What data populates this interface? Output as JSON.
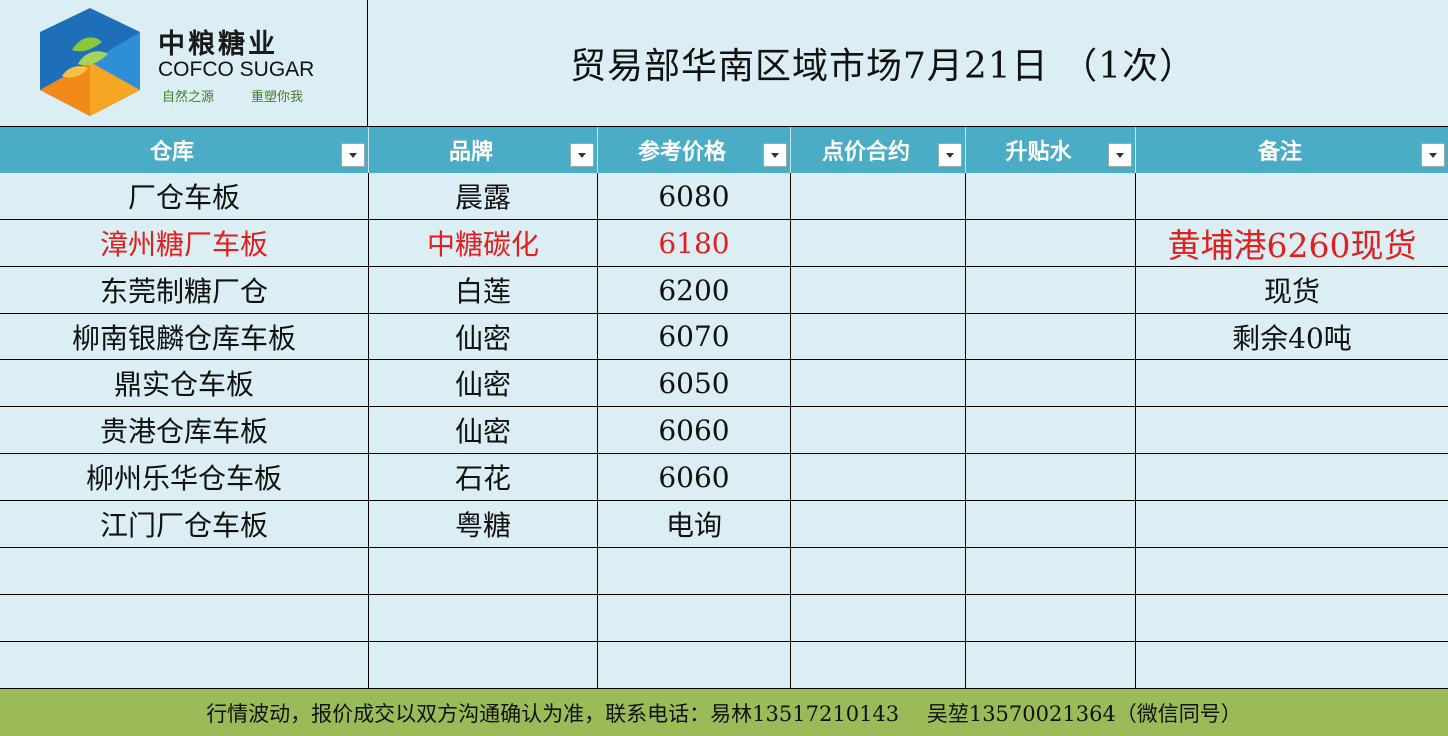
{
  "logo": {
    "name_cn": "中粮糖业",
    "name_en": "COFCO SUGAR",
    "tagline_left": "自然之源",
    "tagline_right": "重塑你我"
  },
  "title": "贸易部华南区域市场7月21日 （1次）",
  "columns": [
    "仓库",
    "品牌",
    "参考价格",
    "点价合约",
    "升贴水",
    "备注"
  ],
  "rows": [
    {
      "warehouse": "厂仓车板",
      "brand": "晨露",
      "price": "6080",
      "contract": "",
      "premium": "",
      "note": "",
      "highlight": false
    },
    {
      "warehouse": "漳州糖厂车板",
      "brand": "中糖碳化",
      "price": "6180",
      "contract": "",
      "premium": "",
      "note": "黄埔港6260现货",
      "highlight": true
    },
    {
      "warehouse": "东莞制糖厂仓",
      "brand": "白莲",
      "price": "6200",
      "contract": "",
      "premium": "",
      "note": "现货",
      "highlight": false
    },
    {
      "warehouse": "柳南银麟仓库车板",
      "brand": "仙密",
      "price": "6070",
      "contract": "",
      "premium": "",
      "note": "剩余40吨",
      "highlight": false
    },
    {
      "warehouse": "鼎实仓车板",
      "brand": "仙密",
      "price": "6050",
      "contract": "",
      "premium": "",
      "note": "",
      "highlight": false
    },
    {
      "warehouse": "贵港仓库车板",
      "brand": "仙密",
      "price": "6060",
      "contract": "",
      "premium": "",
      "note": "",
      "highlight": false
    },
    {
      "warehouse": "柳州乐华仓车板",
      "brand": "石花",
      "price": "6060",
      "contract": "",
      "premium": "",
      "note": "",
      "highlight": false
    },
    {
      "warehouse": "江门厂仓车板",
      "brand": "粤糖",
      "price": "电询",
      "contract": "",
      "premium": "",
      "note": "",
      "highlight": false
    },
    {
      "warehouse": "",
      "brand": "",
      "price": "",
      "contract": "",
      "premium": "",
      "note": "",
      "highlight": false
    },
    {
      "warehouse": "",
      "brand": "",
      "price": "",
      "contract": "",
      "premium": "",
      "note": "",
      "highlight": false
    },
    {
      "warehouse": "",
      "brand": "",
      "price": "",
      "contract": "",
      "premium": "",
      "note": "",
      "highlight": false
    }
  ],
  "footer": "行情波动，报价成交以双方沟通确认为准，联系电话：易林13517210143　 吴堃13570021364（微信同号）",
  "colors": {
    "background": "#daeef3",
    "header": "#4bacc6",
    "footer": "#9bbb59",
    "highlight_text": "#e21e1e"
  },
  "icons": [
    "cofco-logo-icon",
    "filter-dropdown-icon"
  ]
}
